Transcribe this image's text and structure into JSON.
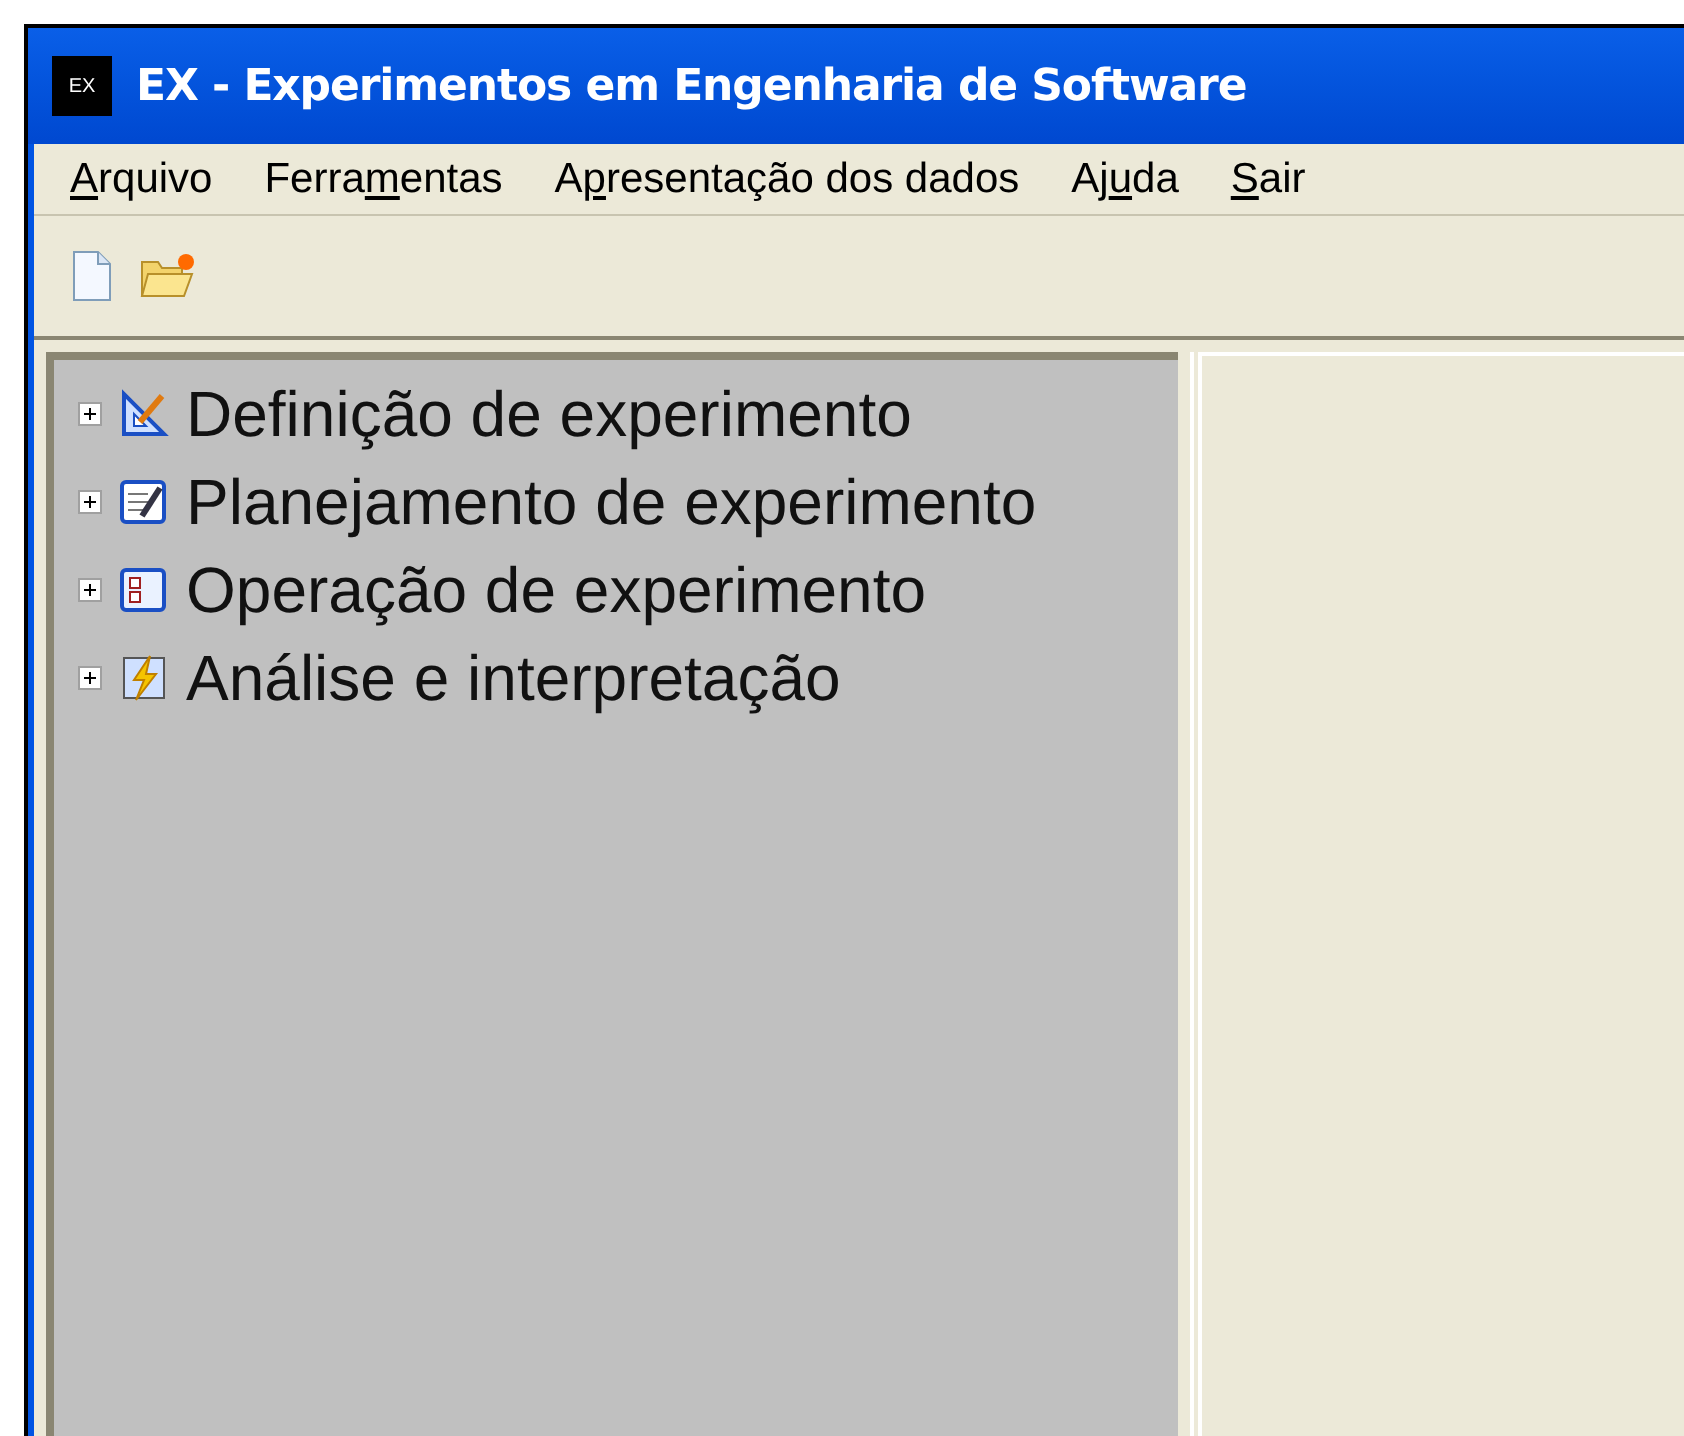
{
  "window": {
    "title": "EX - Experimentos em Engenharia de Software",
    "app_icon": "EX"
  },
  "menu": [
    {
      "key": "A",
      "after": "rquivo"
    },
    {
      "before": "Ferra",
      "key": "m",
      "after": "entas"
    },
    {
      "before": "A",
      "key": "p",
      "after": "resentação dos dados"
    },
    {
      "before": "Aj",
      "key": "u",
      "after": "da"
    },
    {
      "key": "S",
      "after": "air"
    }
  ],
  "toolbar": [
    {
      "kind": "new"
    },
    {
      "kind": "open"
    }
  ],
  "tree": [
    {
      "label": "Definição de experimento",
      "kind": "ruler",
      "expanded": false
    },
    {
      "label": "Planejamento de experimento",
      "kind": "notepad",
      "expanded": false
    },
    {
      "label": "Operação de experimento",
      "kind": "checklist",
      "expanded": false
    },
    {
      "label": "Análise e interpretação",
      "kind": "bolt",
      "expanded": false
    }
  ]
}
